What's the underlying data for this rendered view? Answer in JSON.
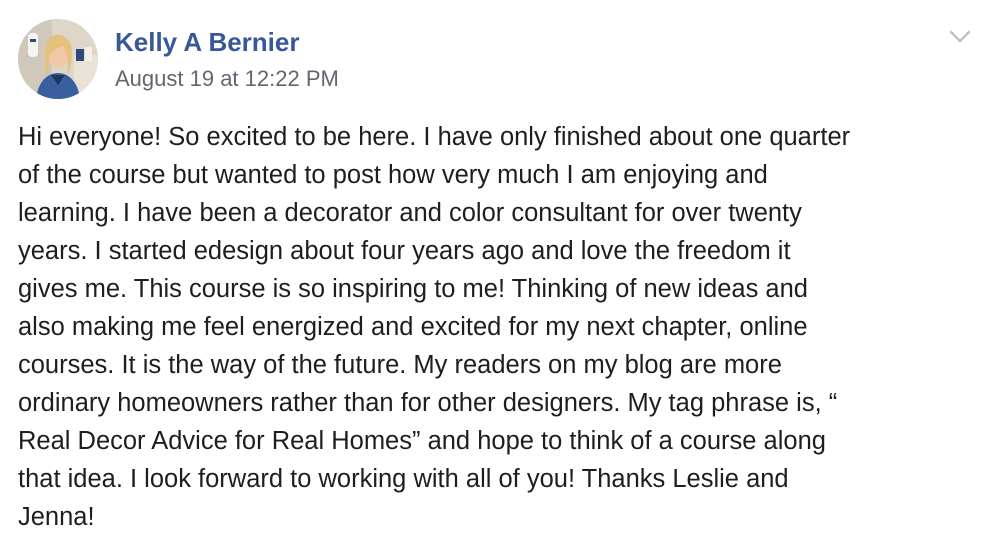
{
  "post": {
    "author": "Kelly A Bernier",
    "timestamp": "August 19 at 12:22 PM",
    "avatar_icon": "profile-photo",
    "options_icon": "chevron-down-icon",
    "body_lines": [
      "Hi everyone! So excited to be here. I have only finished about one quarter",
      "of the course but wanted to post how very much I am enjoying and",
      "learning. I have been a decorator and color consultant for over twenty",
      "years. I started edesign about four years ago and love the freedom it",
      "gives me. This course is so inspiring to me! Thinking of new ideas and",
      "also making me feel energized and excited for my next chapter, online",
      "courses. It is the way of the future. My readers on my blog are more",
      "ordinary homeowners rather than for other designers. My tag phrase is, “",
      "Real Decor Advice for Real Homes” and hope to think of a course along",
      "that idea. I look forward to working with all of you! Thanks Leslie and",
      "Jenna!"
    ]
  },
  "colors": {
    "author_link": "#385898",
    "timestamp": "#616770",
    "body_text": "#1c1e21",
    "chevron": "#bec3c9"
  }
}
